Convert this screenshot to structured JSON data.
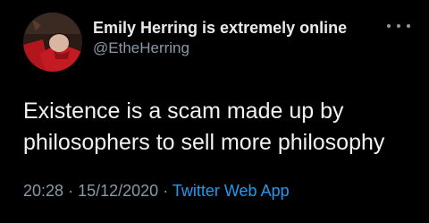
{
  "tweet": {
    "author": {
      "display_name": "Emily Herring is extremely online",
      "handle": "@EtheHerring"
    },
    "more_icon": "more-horizontal-icon",
    "text_lines": [
      "Existence is a scam made up by",
      "philosophers to sell more philosophy"
    ],
    "time": "20:28",
    "separator": "·",
    "date": "15/12/2020",
    "source": "Twitter Web App"
  },
  "colors": {
    "background": "#000000",
    "primary_text": "#e7e9ea",
    "secondary_text": "#8b98a5",
    "link": "#1d9bf0"
  }
}
